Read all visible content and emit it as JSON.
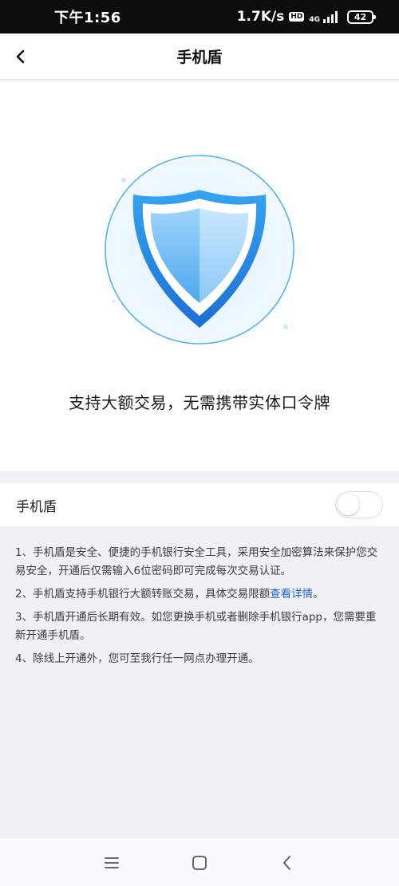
{
  "status_bar": {
    "time": "下午1:56",
    "net_speed": "1.7K/s",
    "hd_label": "HD",
    "network": "4G",
    "battery": "42"
  },
  "header": {
    "title": "手机盾",
    "back_icon": "chevron-left-icon"
  },
  "hero": {
    "icon": "shield-icon",
    "slogan": "支持大额交易，无需携带实体口令牌"
  },
  "toggle": {
    "label": "手机盾",
    "enabled": false
  },
  "notes": {
    "item1": "1、手机盾是安全、便捷的手机银行安全工具，采用安全加密算法来保护您交易安全，开通后仅需输入6位密码即可完成每次交易认证。",
    "item2_prefix": "2、手机盾支持手机银行大额转账交易，具体交易限额",
    "item2_link": "查看详情",
    "item2_suffix": "。",
    "item3": "3、手机盾开通后长期有效。如您更换手机或者删除手机银行app，您需要重新开通手机盾。",
    "item4": "4、除线上开通外，您可至我行任一网点办理开通。"
  },
  "system_nav": {
    "menu_icon": "menu-icon",
    "home_icon": "home-icon",
    "back_icon": "back-triangle-icon"
  },
  "colors": {
    "shield_blue": "#2f8fe3",
    "link_blue": "#1f63c6",
    "page_background": "#f1f0f5"
  }
}
